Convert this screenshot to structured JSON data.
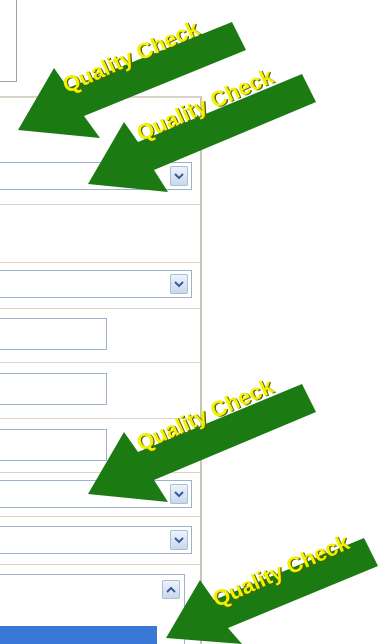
{
  "annotations": [
    {
      "label": "Quality Check"
    },
    {
      "label": "Quality Check"
    },
    {
      "label": "Quality Check"
    },
    {
      "label": "Quality Check"
    }
  ],
  "icons": {
    "dropdown": "chevron-down-icon",
    "scroll_up": "chevron-up-icon"
  },
  "colors": {
    "arrow_fill": "#1b7a12",
    "label_text": "#f2f200",
    "field_border": "#9db3cc",
    "selection": "#3a78d8"
  }
}
